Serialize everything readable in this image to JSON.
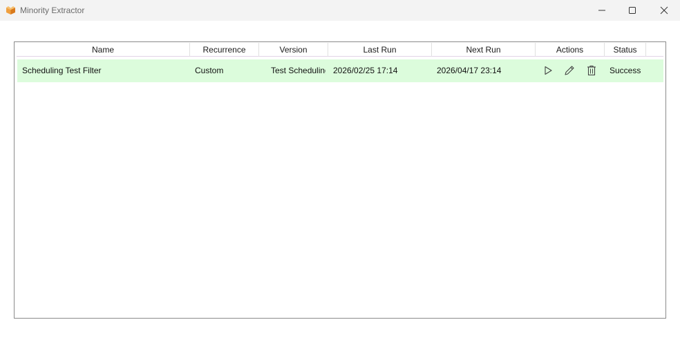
{
  "window": {
    "title": "Minority Extractor"
  },
  "icons": {
    "app": "app-logo-icon",
    "minimize": "minimize-icon",
    "maximize": "maximize-icon",
    "close": "close-icon",
    "run": "play-icon",
    "edit": "pencil-icon",
    "delete": "trash-icon"
  },
  "colors": {
    "titlebar_bg": "#f3f3f3",
    "row_highlight": "#dcfcdc",
    "grid_border": "#8a8a8a",
    "app_icon": "#e8912c"
  },
  "grid": {
    "columns": [
      "Name",
      "Recurrence",
      "Version",
      "Last Run",
      "Next Run",
      "Actions",
      "Status"
    ],
    "rows": [
      {
        "name": "Scheduling Test Filter",
        "recurrence": "Custom",
        "version": "Test Scheduling",
        "last_run": "2026/02/25 17:14",
        "next_run": "2026/04/17 23:14",
        "status": "Success"
      }
    ]
  }
}
